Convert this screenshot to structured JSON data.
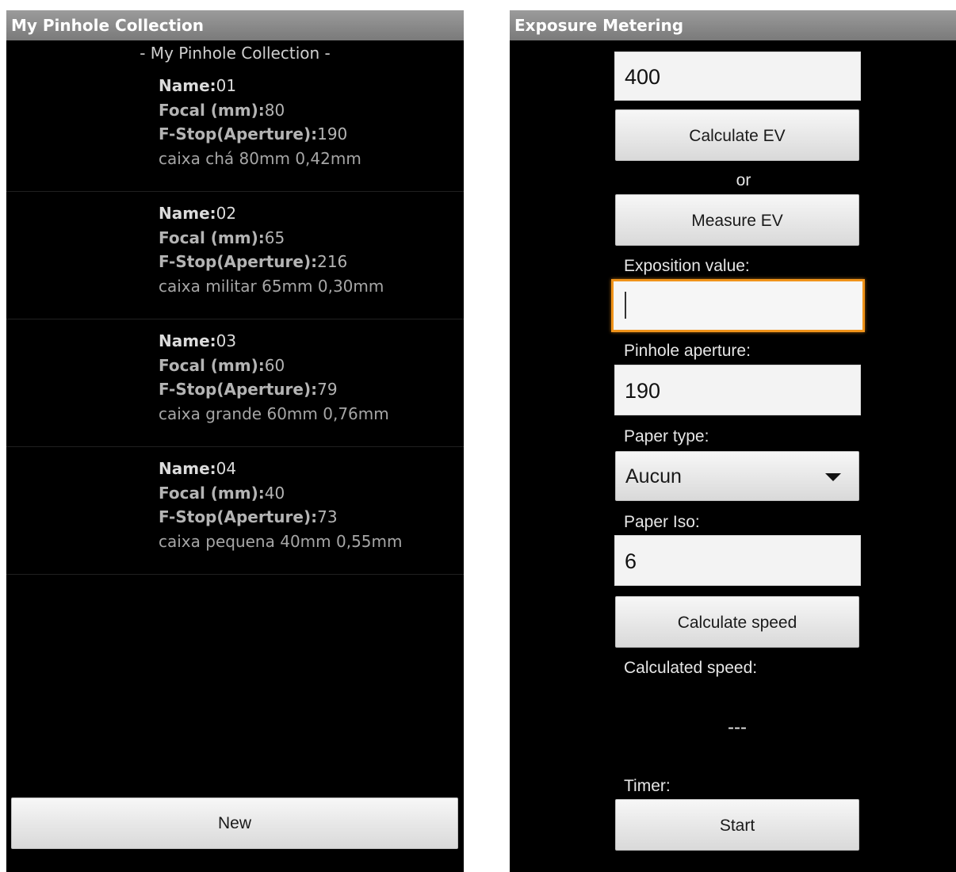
{
  "left": {
    "title": "My Pinhole Collection",
    "header": "- My Pinhole Collection -",
    "labels": {
      "name": "Name:",
      "focal": "Focal (mm):",
      "fstop": "F-Stop(Aperture):"
    },
    "items": [
      {
        "name": "01",
        "focal": "80",
        "fstop": "190",
        "desc": "caixa chá 80mm 0,42mm"
      },
      {
        "name": "02",
        "focal": "65",
        "fstop": "216",
        "desc": "caixa militar 65mm 0,30mm"
      },
      {
        "name": "03",
        "focal": "60",
        "fstop": "79",
        "desc": "caixa grande 60mm 0,76mm"
      },
      {
        "name": "04",
        "focal": "40",
        "fstop": "73",
        "desc": "caixa pequena 40mm 0,55mm"
      }
    ],
    "new_button": "New"
  },
  "right": {
    "title": "Exposure Metering",
    "iso_value": "400",
    "calculate_ev_button": "Calculate EV",
    "or_text": "or",
    "measure_ev_button": "Measure EV",
    "exposition_label": "Exposition value:",
    "exposition_value": "",
    "aperture_label": "Pinhole aperture:",
    "aperture_value": "190",
    "paper_type_label": "Paper type:",
    "paper_type_value": "Aucun",
    "paper_iso_label": "Paper Iso:",
    "paper_iso_value": "6",
    "calculate_speed_button": "Calculate speed",
    "calculated_speed_label": "Calculated speed:",
    "calculated_speed_value": "---",
    "timer_label": "Timer:",
    "start_button": "Start",
    "colors": {
      "focus_accent": "#f0931a",
      "titlebar": "#8a8a8a",
      "background": "#000000"
    }
  }
}
